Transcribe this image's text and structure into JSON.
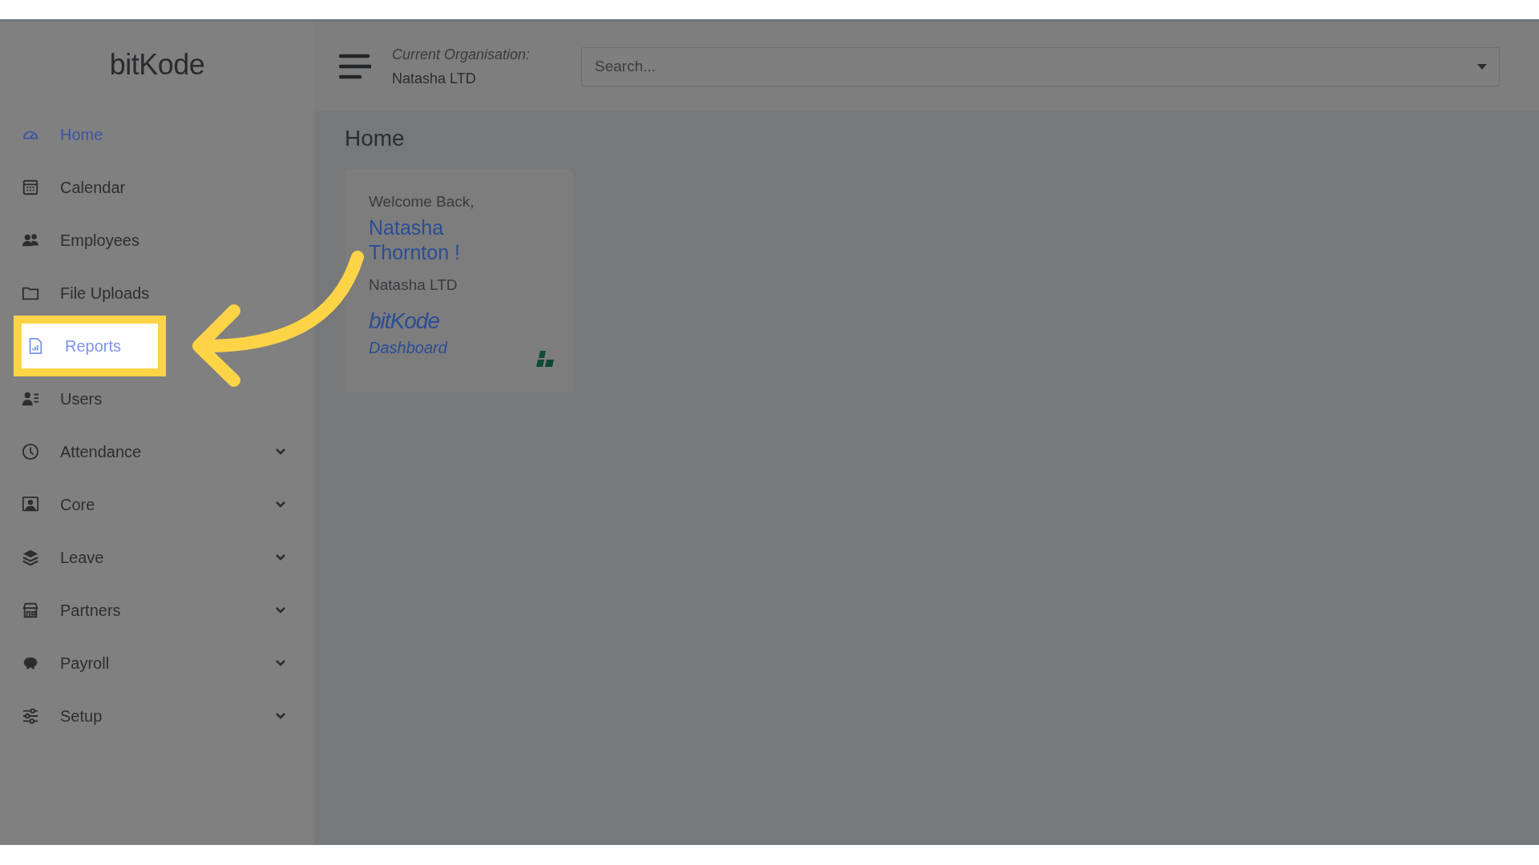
{
  "sidebar": {
    "logo": "bitKode",
    "items": [
      {
        "label": "Home",
        "kind": "link",
        "selected": true,
        "highlighted": false
      },
      {
        "label": "Calendar",
        "kind": "link",
        "selected": false,
        "highlighted": false
      },
      {
        "label": "Employees",
        "kind": "link",
        "selected": false,
        "highlighted": false
      },
      {
        "label": "File Uploads",
        "kind": "link",
        "selected": false,
        "highlighted": false
      },
      {
        "label": "Reports",
        "kind": "link",
        "selected": false,
        "highlighted": true
      },
      {
        "label": "Users",
        "kind": "link",
        "selected": false,
        "highlighted": false
      },
      {
        "label": "Attendance",
        "kind": "group",
        "selected": false,
        "highlighted": false,
        "expanded": false
      },
      {
        "label": "Core",
        "kind": "group",
        "selected": false,
        "highlighted": false,
        "expanded": false
      },
      {
        "label": "Leave",
        "kind": "group",
        "selected": false,
        "highlighted": false,
        "expanded": false
      },
      {
        "label": "Partners",
        "kind": "group",
        "selected": false,
        "highlighted": false,
        "expanded": false
      },
      {
        "label": "Payroll",
        "kind": "group",
        "selected": false,
        "highlighted": false,
        "expanded": false
      },
      {
        "label": "Setup",
        "kind": "group",
        "selected": false,
        "highlighted": false,
        "expanded": false
      }
    ]
  },
  "topbar": {
    "org_label": "Current Organisation:",
    "org_name": "Natasha LTD",
    "search": {
      "placeholder": "Search..."
    }
  },
  "page": {
    "title": "Home",
    "card": {
      "greeting": "Welcome Back,",
      "name": "Natasha Thornton !",
      "organisation": "Natasha LTD",
      "brand": "bitKode",
      "subtitle": "Dashboard"
    }
  }
}
